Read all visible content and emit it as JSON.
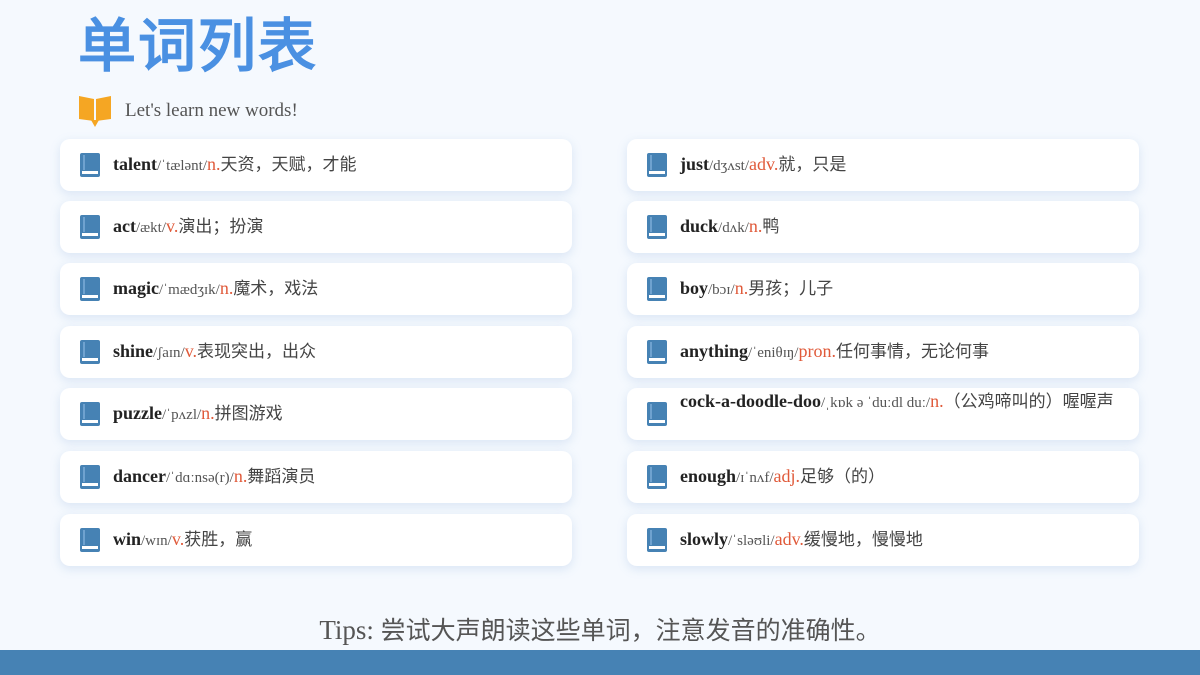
{
  "title": "单词列表",
  "subtitle": "Let's learn new words!",
  "tips": {
    "prefix": "Tips: ",
    "text": "尝试大声朗读这些单词，注意发音的准确性。"
  },
  "colors": {
    "title": "#4a90e2",
    "bookmark": "#f5a623",
    "book_icon": "#4682b4",
    "part_of_speech": "#e05a3a",
    "footer_bar": "#4682b4"
  },
  "icons": {
    "bookmark": "open-book-icon",
    "card": "book-icon"
  },
  "words_left": [
    {
      "word": "talent",
      "ipa": "/ˈtælənt/",
      "pos": "n.",
      "meaning": "天资，天赋，才能"
    },
    {
      "word": "act",
      "ipa": "/ækt/",
      "pos": "v.",
      "meaning": "演出；扮演"
    },
    {
      "word": "magic",
      "ipa": "/ˈmædʒɪk/",
      "pos": "n.",
      "meaning": "魔术，戏法"
    },
    {
      "word": "shine",
      "ipa": "/ʃaɪn/",
      "pos": "v.",
      "meaning": "表现突出，出众"
    },
    {
      "word": "puzzle",
      "ipa": "/ˈpʌzl/",
      "pos": "n.",
      "meaning": "拼图游戏"
    },
    {
      "word": "dancer",
      "ipa": "/ˈdɑːnsə(r)/",
      "pos": "n.",
      "meaning": "舞蹈演员"
    },
    {
      "word": "win",
      "ipa": "/wɪn/",
      "pos": "v.",
      "meaning": "获胜，赢"
    }
  ],
  "words_right": [
    {
      "word": "just",
      "ipa": "/dʒʌst/",
      "pos": "adv.",
      "meaning": "就，只是"
    },
    {
      "word": "duck",
      "ipa": "/dʌk/",
      "pos": "n.",
      "meaning": "鸭"
    },
    {
      "word": "boy",
      "ipa": "/bɔɪ/",
      "pos": "n.",
      "meaning": "男孩；儿子"
    },
    {
      "word": "anything",
      "ipa": "/ˈeniθɪŋ/",
      "pos": "pron.",
      "meaning": "任何事情，无论何事"
    },
    {
      "word": "cock-a-doodle-doo",
      "ipa": "/ˌkɒk ə ˈduːdl duː/",
      "pos": "n.",
      "meaning": "（公鸡啼叫的）喔喔声"
    },
    {
      "word": "enough",
      "ipa": "/ɪˈnʌf/",
      "pos": "adj.",
      "meaning": "足够（的）"
    },
    {
      "word": "slowly",
      "ipa": "/ˈsləʊli/",
      "pos": "adv.",
      "meaning": "缓慢地，慢慢地"
    }
  ]
}
